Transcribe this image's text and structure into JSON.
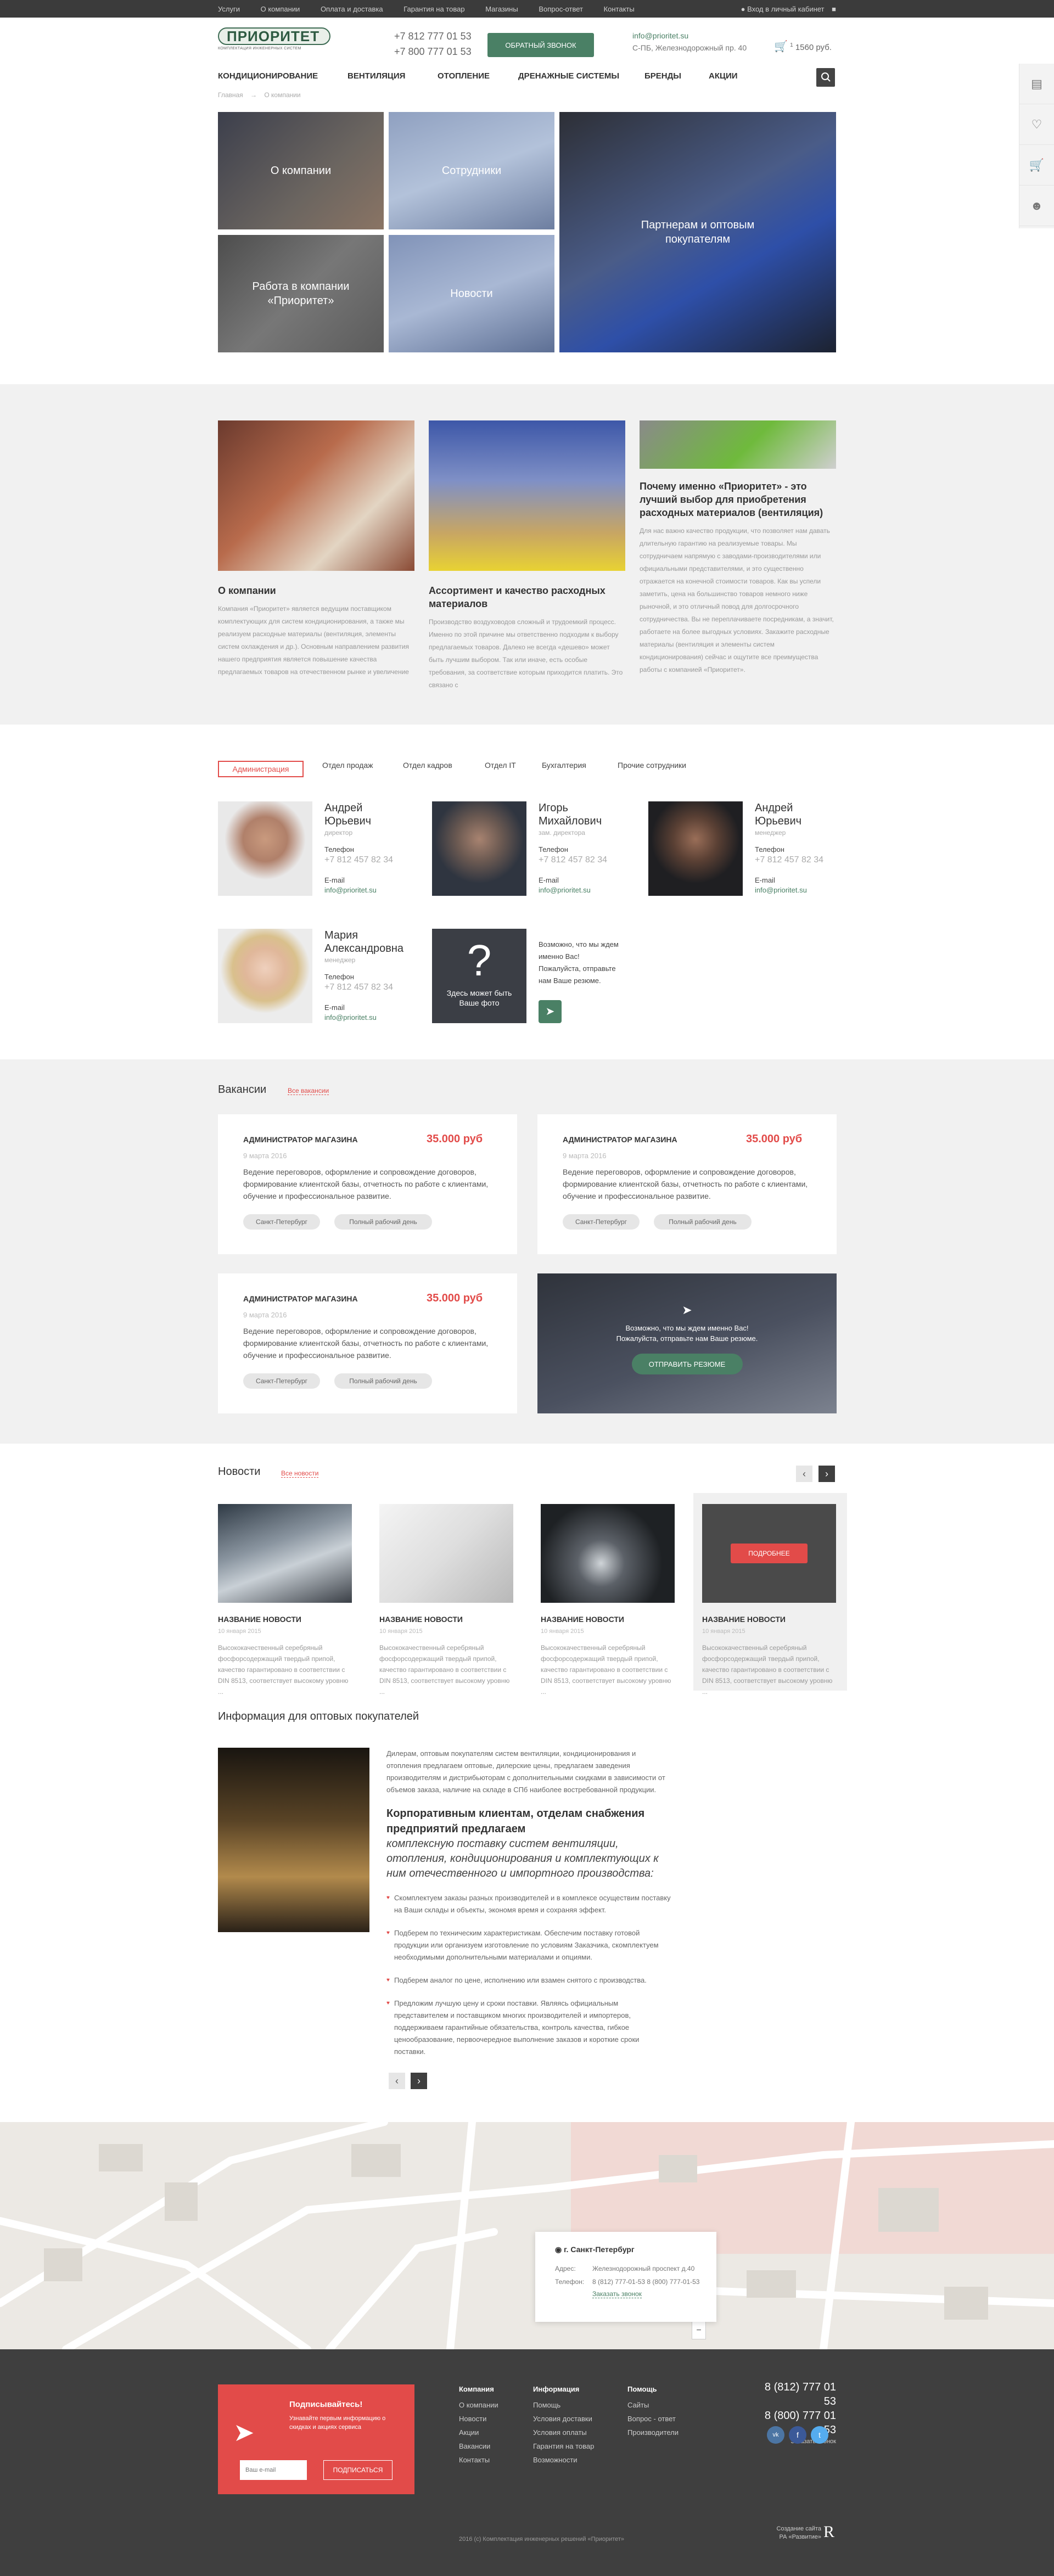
{
  "topbar": {
    "links": [
      "Услуги",
      "О компании",
      "Оплата и доставка",
      "Гарантия на товар",
      "Магазины",
      "Вопрос-ответ",
      "Контакты"
    ],
    "cabinet": "Вход в личный кабинет"
  },
  "header": {
    "logo": "ПРИОРИТЕТ",
    "logo_sub": "КОМПЛЕКТАЦИЯ ИНЖЕНЕРНЫХ СИСТЕМ",
    "phone1": "+7 812 777 01 53",
    "phone2": "+7 800 777 01 53",
    "callback": "ОБРАТНЫЙ ЗВОНОК",
    "email": "info@prioritet.su",
    "address": "С-ПБ, Железнодорожный пр. 40",
    "cart_count": "1",
    "cart_total": "1560 руб."
  },
  "nav": [
    "КОНДИЦИОНИРОВАНИЕ",
    "ВЕНТИЛЯЦИЯ",
    "ОТОПЛЕНИЕ",
    "ДРЕНАЖНЫЕ СИСТЕМЫ",
    "БРЕНДЫ",
    "АКЦИИ"
  ],
  "breadcrumbs": {
    "home": "Главная",
    "current": "О компании"
  },
  "hero": {
    "tile1": "О компании",
    "tile2": "Сотрудники",
    "tile3": "Партнерам и оптовым покупателям",
    "tile4": "Работа в компании «Приоритет»",
    "tile5": "Новости"
  },
  "about": [
    {
      "title": "О компании",
      "text": "Компания «Приоритет» является ведущим поставщиком комплектующих для систем кондиционирования, а также мы реализуем расходные материалы (вентиляция, элементы систем охлаждения и др.). Основным направлением развития нашего предприятия является повышение качества предлагаемых товаров на отечественном рынке и увеличение"
    },
    {
      "title": "Ассортимент и качество расходных материалов",
      "text": "Производство воздуховодов сложный и трудоемкий процесс. Именно по этой причине мы ответственно подходим к выбору предлагаемых товаров. Далеко не всегда «дешево» может быть лучшим выбором. Так или иначе, есть особые требования, за соответствие которым приходится платить. Это связано с"
    },
    {
      "title": "Почему именно «Приоритет» - это лучший выбор для приобретения расходных материалов (вентиляция)",
      "text": "Для нас важно качество продукции, что позволяет нам давать длительную гарантию на реализуемые товары. Мы сотрудничаем напрямую с заводами-производителями или официальными представителями, и это существенно отражается на конечной стоимости товаров. Как вы успели заметить, цена на большинство товаров немного ниже рыночной, и это отличный повод для долгосрочного сотрудничества. Вы не переплачиваете посредникам, а значит, работаете на более выгодных условиях. Закажите расходные материалы (вентиляция и элементы систем кондиционирования) сейчас и ощутите все преимущества работы с компанией «Приоритет»."
    }
  ],
  "tabs": [
    "Администрация",
    "Отдел продаж",
    "Отдел кадров",
    "Отдел IT",
    "Бухгалтерия",
    "Прочие сотрудники"
  ],
  "employees": [
    {
      "name1": "Андрей",
      "name2": "Юрьевич",
      "role": "директор",
      "phone_label": "Телефон",
      "phone": "+7 812 457 82 34",
      "mail_label": "E-mail",
      "mail": "info@prioritet.su"
    },
    {
      "name1": "Игорь",
      "name2": "Михайлович",
      "role": "зам. директора",
      "phone_label": "Телефон",
      "phone": "+7 812 457 82 34",
      "mail_label": "E-mail",
      "mail": "info@prioritet.su"
    },
    {
      "name1": "Андрей",
      "name2": "Юрьевич",
      "role": "менеджер",
      "phone_label": "Телефон",
      "phone": "+7 812 457 82 34",
      "mail_label": "E-mail",
      "mail": "info@prioritet.su"
    },
    {
      "name1": "Мария",
      "name2": "Александровна",
      "role": "менеджер",
      "phone_label": "Телефон",
      "phone": "+7 812 457 82 34",
      "mail_label": "E-mail",
      "mail": "info@prioritet.su"
    }
  ],
  "placeholder_emp": {
    "q": "?",
    "label": "Здесь может быть Ваше фото",
    "text": "Возможно, что мы ждем именно Вас! Пожалуйста, отправьте нам Ваше резюме."
  },
  "vacancies": {
    "title": "Вакансии",
    "all": "Все вакансии",
    "item": {
      "title": "АДМИНИСТРАТОР МАГАЗИНА",
      "price": "35.000 руб",
      "date": "9 марта 2016",
      "text": "Ведение переговоров, оформление и сопровождение договоров, формирование клиентской базы, отчетность по работе с клиентами, обучение и профессиональное развитие.",
      "tag1": "Санкт-Петербург",
      "tag2": "Полный рабочий день"
    },
    "cta_text1": "Возможно, что мы ждем именно Вас!",
    "cta_text2": "Пожалуйста, отправьте нам Ваше резюме.",
    "cta_button": "ОТПРАВИТЬ РЕЗЮМЕ"
  },
  "news": {
    "title": "Новости",
    "all": "Все новости",
    "more": "ПОДРОБНЕЕ",
    "item": {
      "title": "НАЗВАНИЕ НОВОСТИ",
      "date": "10 января 2015",
      "text": "Высококачественный серебряный фосфорсодержащий твердый припой, качество гарантировано в соответствии с DIN 8513, соответствует высокому уровню ..."
    }
  },
  "wholesale": {
    "title": "Информация для оптовых покупателей",
    "intro": "Дилерам, оптовым покупателям систем вентиляции, кондиционирования и отопления предлагаем оптовые, дилерские цены, предлагаем заведения производителям и дистрибьюторам с дополнительными скидками в зависимости от объемов заказа, наличие на складе в СПб наиболее востребованной продукции.",
    "head": "Корпоративным клиентам, отделам снабжения предприятий предлагаем",
    "italic": "комплексную поставку систем вентиляции, отопления, кондиционирования и комплектующих к ним отечественного и импортного производства:",
    "items": [
      "Скомплектуем заказы разных производителей и в комплексе осуществим поставку на Ваши склады и объекты, экономя время и сохраняя эффект.",
      "Подберем по техническим характеристикам. Обеспечим поставку готовой продукции или организуем изготовление по условиям Заказчика, скомплектуем необходимыми дополнительными материалами и опциями.",
      "Подберем аналог по цене, исполнению или взамен снятого с производства.",
      "Предложим лучшую цену и сроки поставки. Являясь официальным представителем и поставщиком многих производителей и импортеров, поддерживаем гарантийные обязательства, контроль качества, гибкое ценообразование, первоочередное выполнение заказов и короткие сроки поставки."
    ]
  },
  "map": {
    "city": "г. Санкт-Петербург",
    "addr_label": "Адрес:",
    "addr": "Железнодорожный проспект д.40",
    "phone_label": "Телефон:",
    "phones": "8 (812) 777-01-53   8 (800) 777-01-53",
    "call": "Заказать звонок"
  },
  "footer": {
    "sub_title": "Подписывайтесь!",
    "sub_text": "Узнавайте первым информацию о скидках и акциях сервиса",
    "sub_placeholder": "Ваш e-mail",
    "sub_button": "ПОДПИСАТЬСЯ",
    "col1": {
      "h": "Компания",
      "items": [
        "О компании",
        "Новости",
        "Акции",
        "Вакансии",
        "Контакты"
      ]
    },
    "col2": {
      "h": "Информация",
      "items": [
        "Помощь",
        "Условия доставки",
        "Условия оплаты",
        "Гарантия на товар",
        "Возможности"
      ]
    },
    "col3": {
      "h": "Помощь",
      "items": [
        "Сайты",
        "Вопрос - ответ",
        "Производители"
      ]
    },
    "phone1": "8 (812) 777 01 53",
    "phone2": "8 (800) 777 01 53",
    "call": "Заказать звонок",
    "copyright": "2016 (с) Комплектация инженерных решений «Приоритет»",
    "dev1": "Создание сайта",
    "dev2": "РА «Развитие»"
  }
}
